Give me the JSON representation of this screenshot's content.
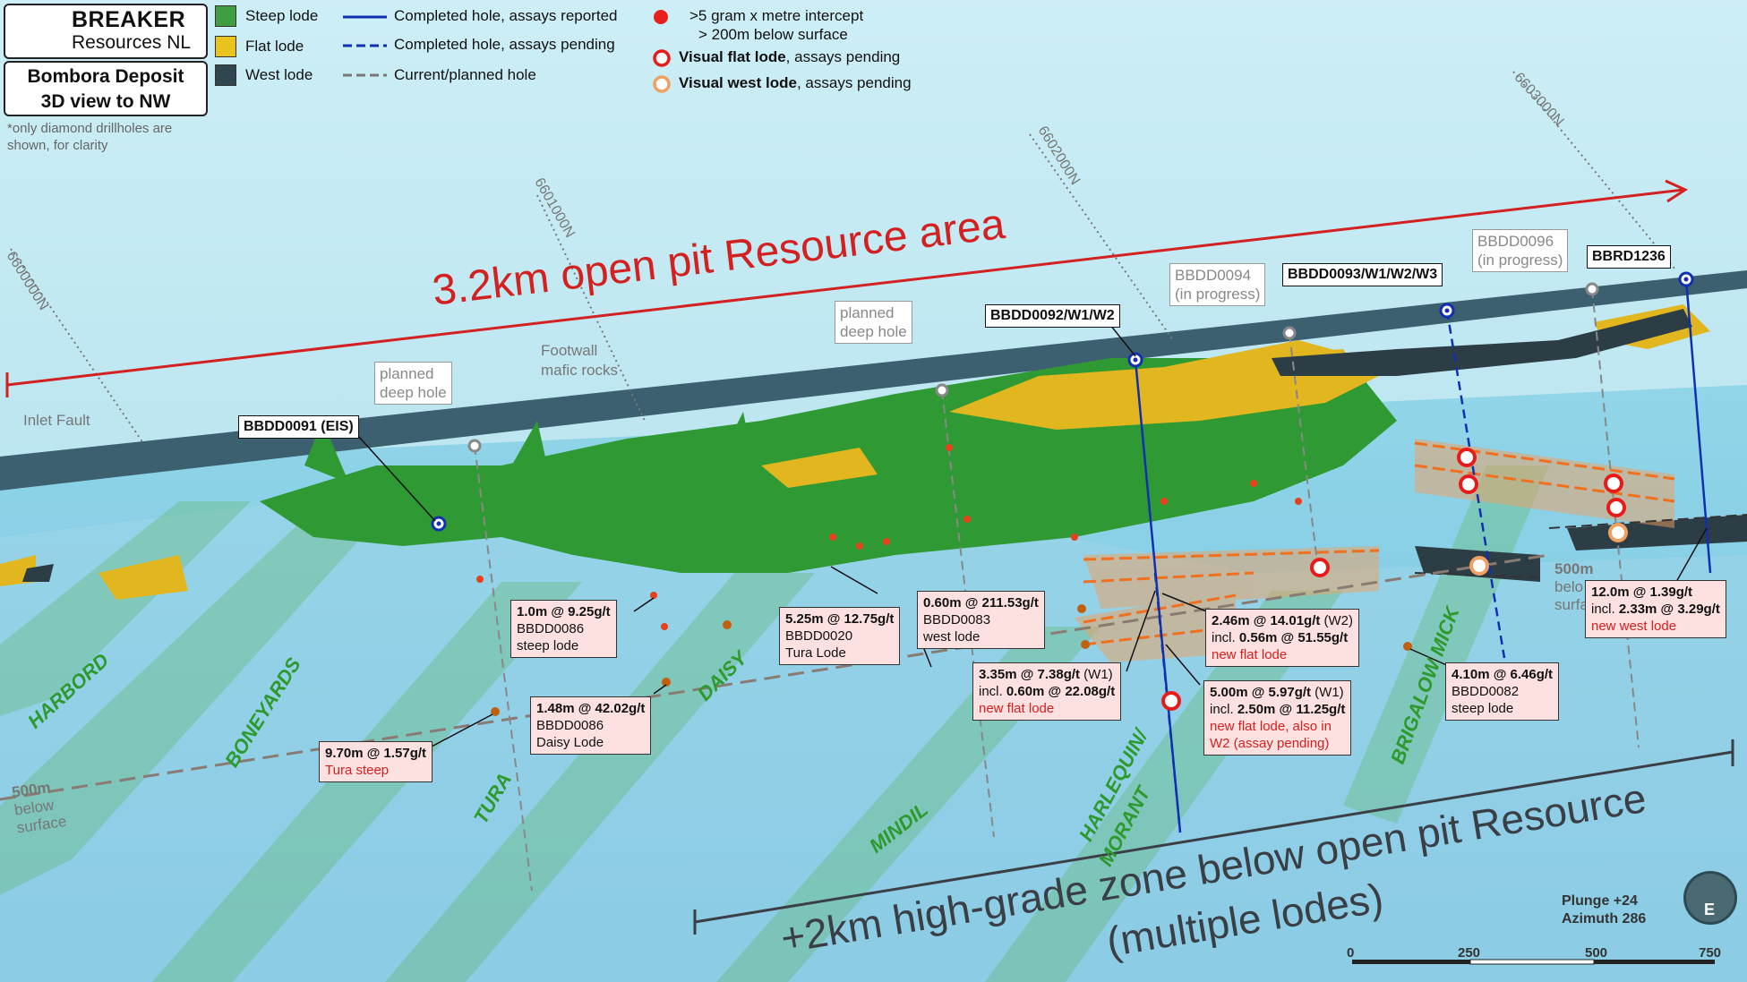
{
  "logo": {
    "name": "BREAKER",
    "sub": "Resources NL"
  },
  "deposit": {
    "line1": "Bombora Deposit",
    "line2": "3D view to NW"
  },
  "note": "*only diamond drillholes are shown, for clarity",
  "legend": {
    "steep": "Steep lode",
    "flat": "Flat lode",
    "west": "West lode",
    "completed": "Completed hole, assays reported",
    "pending": "Completed hole, assays pending",
    "planned": "Current/planned hole",
    "intercept_line1": ">5 gram x metre intercept",
    "intercept_line2": "> 200m below surface",
    "visual_flat_b": "Visual flat lode",
    "visual_flat_rest": ", assays pending",
    "visual_west_b": "Visual west lode",
    "visual_west_rest": ", assays pending"
  },
  "colors": {
    "steep": "#3f9e3f",
    "flat": "#e8c31e",
    "west": "#2f4650",
    "red": "#d32020",
    "blue": "#1030b0",
    "orange": "#f08030"
  },
  "headline_top": "3.2km open pit Resource area",
  "headline_bottom_1": "+2km high-grade zone below open pit Resource",
  "headline_bottom_2": "(multiple lodes)",
  "grid": [
    "6600000N",
    "6601000N",
    "6602000N",
    "6603000N"
  ],
  "labels": {
    "inlet_fault": "Inlet Fault",
    "footwall_1": "Footwall",
    "footwall_2": "mafic rocks",
    "depth_left_1": "500m",
    "depth_left_2": "below",
    "depth_left_3": "surface",
    "depth_right_1": "500m",
    "depth_right_2": "belo",
    "depth_right_3": "surfa"
  },
  "lodes": [
    "HARBORD",
    "BONEYARDS",
    "TURA",
    "DAISY",
    "MINDIL",
    "HARLEQUIN/",
    "MORANT",
    "BRIGALOW MICK"
  ],
  "drillholes": {
    "d91": "BBDD0091 (EIS)",
    "d92": "BBDD0092/W1/W2",
    "d93": "BBDD0093/W1/W2/W3",
    "r1236": "BBRD1236"
  },
  "grey_holes": {
    "p1_1": "planned",
    "p1_2": "deep hole",
    "p2_1": "planned",
    "p2_2": "deep hole",
    "d94_1": "BBDD0094",
    "d94_2": "(in progress)",
    "d96_1": "BBDD0096",
    "d96_2": "(in progress)"
  },
  "callouts": {
    "c1": {
      "h": "1.0m @ 9.25g/t",
      "l2": "BBDD0086",
      "l3": "steep lode"
    },
    "c2": {
      "h": "9.70m @ 1.57g/t",
      "r": "Tura steep"
    },
    "c3": {
      "h": "1.48m @ 42.02g/t",
      "l2": "BBDD0086",
      "l3": "Daisy Lode"
    },
    "c4": {
      "h": "5.25m @ 12.75g/t",
      "l2": "BBDD0020",
      "l3": "Tura Lode"
    },
    "c5": {
      "h": "0.60m @ 211.53g/t",
      "l2": "BBDD0083",
      "l3": "west lode"
    },
    "c6": {
      "h": "3.35m @ 7.38g/t",
      "h2": " (W1)",
      "l2a": "incl. ",
      "l2b": "0.60m @ 22.08g/t",
      "r": "new flat lode"
    },
    "c7": {
      "h": "2.46m @ 14.01g/t",
      "h2": " (W2)",
      "l2a": "incl. ",
      "l2b": "0.56m @ 51.55g/t",
      "r": "new flat lode"
    },
    "c8": {
      "h": "5.00m @ 5.97g/t",
      "h2": " (W1)",
      "l2a": "incl. ",
      "l2b": "2.50m @ 11.25g/t",
      "r1": "new flat lode, also in",
      "r2": "W2 (assay pending)"
    },
    "c9": {
      "h": "4.10m @ 6.46g/t",
      "l2": "BBDD0082",
      "l3": "steep lode"
    },
    "c10": {
      "h": "12.0m @ 1.39g/t",
      "l2a": "incl. ",
      "l2b": "2.33m @ 3.29g/t",
      "r": "new west lode"
    }
  },
  "orientation": {
    "plunge": "Plunge +24",
    "azimuth": "Azimuth 286",
    "compass": "E"
  },
  "scale": [
    "0",
    "250",
    "500",
    "750"
  ]
}
